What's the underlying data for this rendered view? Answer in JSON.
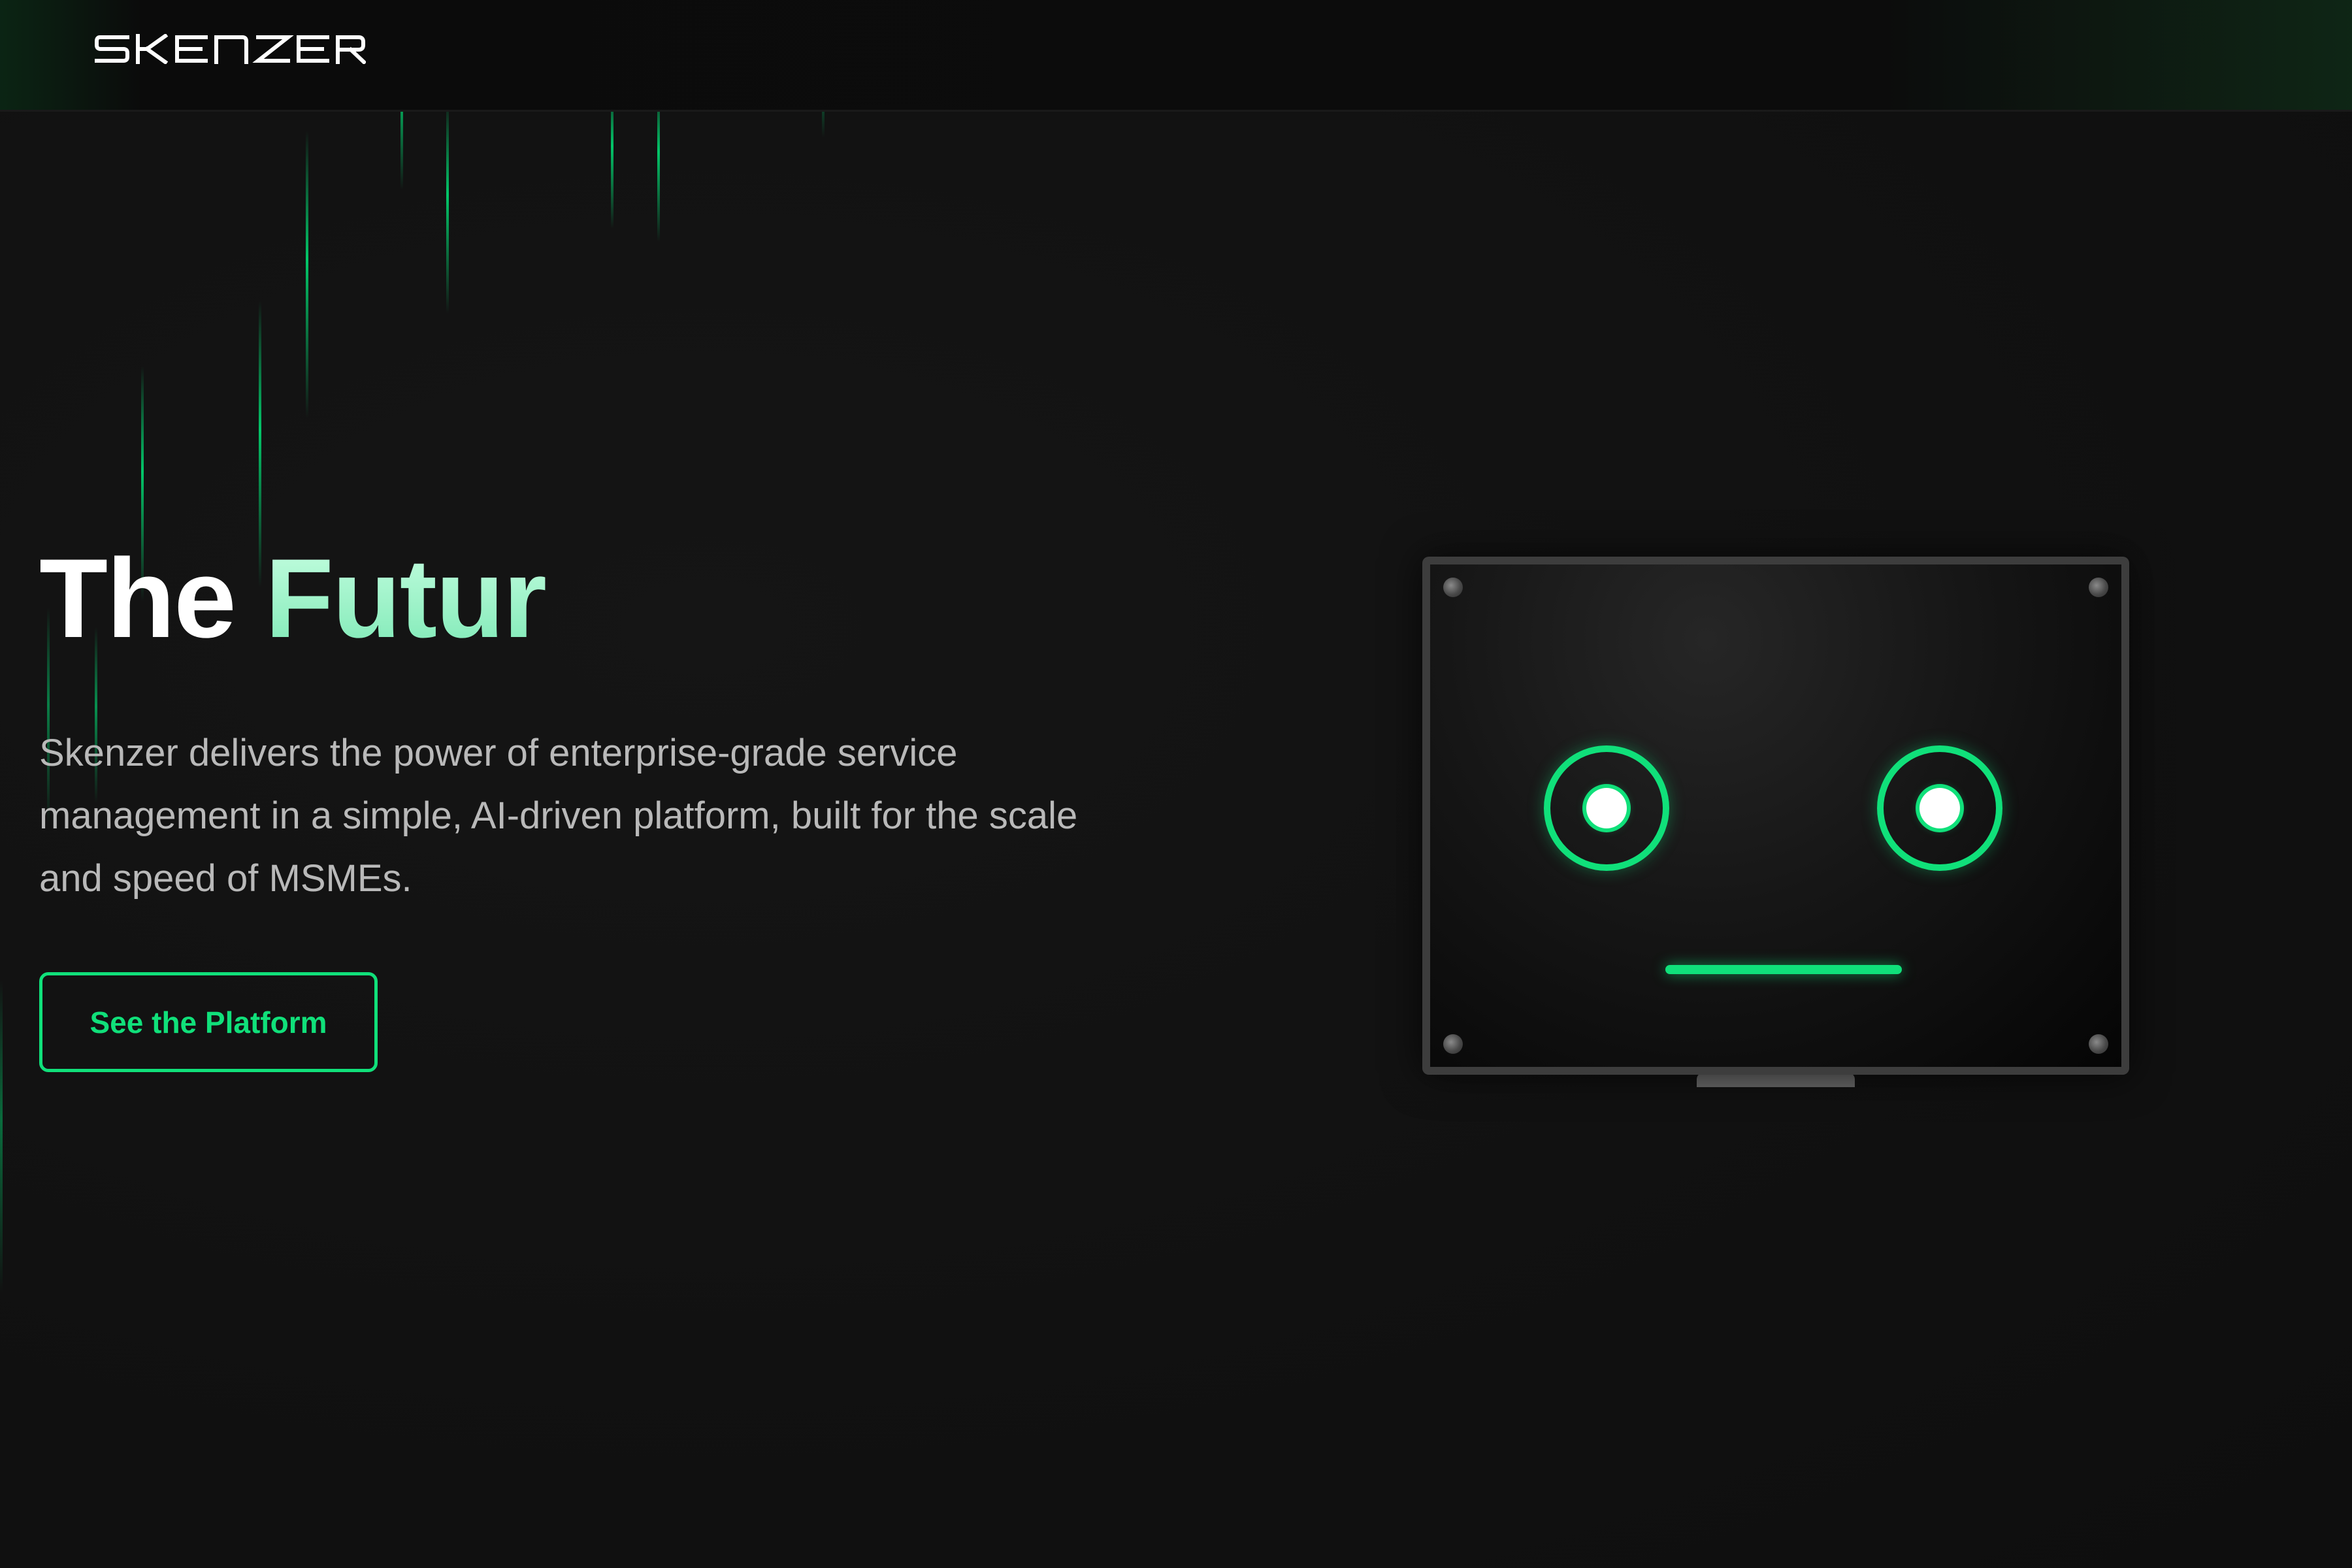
{
  "brand": {
    "name": "SKENZER",
    "accent_color": "#10e07a",
    "background_color": "#111111"
  },
  "hero": {
    "title_part1": "The",
    "title_part2": "Futur",
    "description": "Skenzer delivers the power of enterprise-grade service management in a simple, AI-driven platform, built for the scale and speed of MSMEs.",
    "cta_label": "See the Platform"
  },
  "illustration": {
    "icon": "robot-monitor-face",
    "expression": "neutral"
  }
}
